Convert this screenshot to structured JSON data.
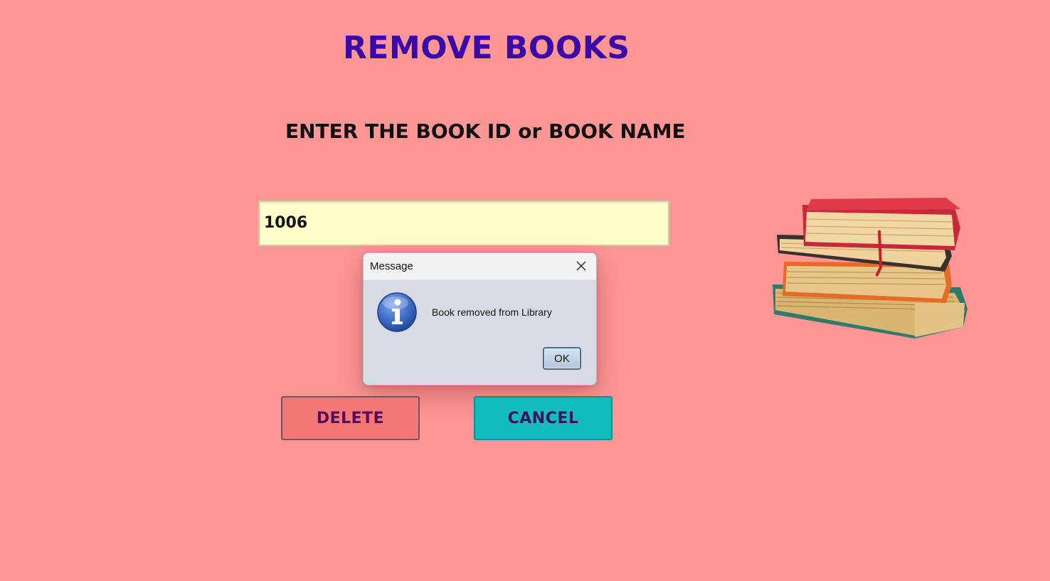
{
  "app": {
    "title": "REMOVE BOOKS",
    "prompt": "ENTER THE BOOK ID or BOOK NAME"
  },
  "form": {
    "book_input_value": "1006"
  },
  "buttons": {
    "delete_label": "DELETE",
    "cancel_label": "CANCEL"
  },
  "dialog": {
    "title": "Message",
    "message": "Book removed from Library",
    "ok_label": "OK",
    "icon": "info-icon"
  },
  "colors": {
    "background": "#ff9696",
    "title": "#3a0aa8",
    "input_bg": "#ffffcc",
    "delete_bg": "#f27878",
    "cancel_bg": "#11bcbc",
    "dialog_bg": "#d8dbe3"
  },
  "illustration": {
    "icon": "stack-of-books-icon"
  }
}
